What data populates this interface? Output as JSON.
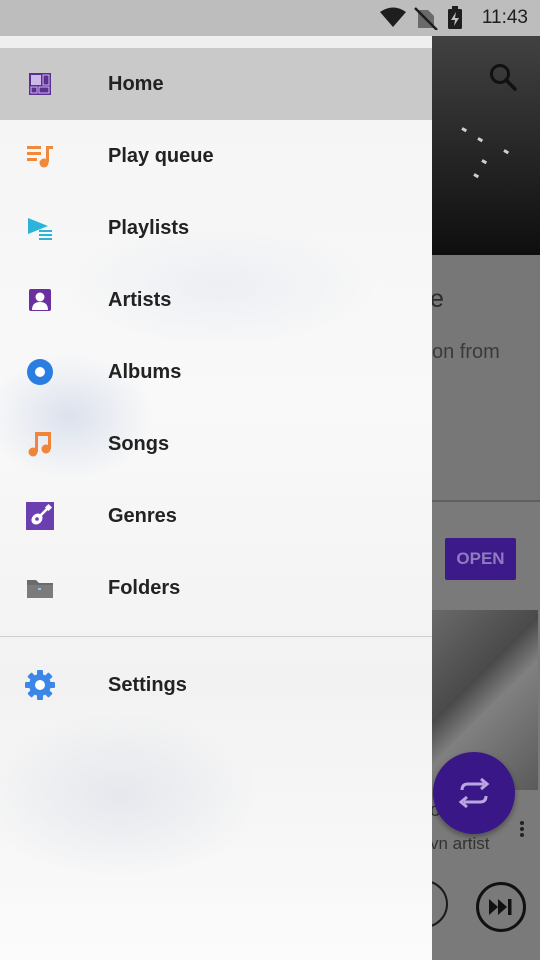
{
  "status_bar": {
    "time": "11:43",
    "icons": [
      "wifi-icon",
      "no-sim-icon",
      "battery-charging-icon"
    ]
  },
  "background": {
    "card_title_fragment": "e",
    "card_sub_fragment": "on from",
    "open_button": "OPEN",
    "album_title_fragment": "o",
    "album_artist_fragment": "vn artist"
  },
  "drawer": {
    "items": [
      {
        "label": "Home",
        "icon": "home-icon",
        "color": "#5b2e91",
        "active": true
      },
      {
        "label": "Play queue",
        "icon": "play-queue-icon",
        "color": "#f08a3a"
      },
      {
        "label": "Playlists",
        "icon": "playlists-icon",
        "color": "#2bb3d9"
      },
      {
        "label": "Artists",
        "icon": "artists-icon",
        "color": "#6a2fa0"
      },
      {
        "label": "Albums",
        "icon": "albums-icon",
        "color": "#2a7de1"
      },
      {
        "label": "Songs",
        "icon": "songs-icon",
        "color": "#f0843a"
      },
      {
        "label": "Genres",
        "icon": "genres-icon",
        "color": "#6a3fb0"
      },
      {
        "label": "Folders",
        "icon": "folders-icon",
        "color": "#6b6b6b"
      }
    ],
    "settings": {
      "label": "Settings",
      "icon": "settings-icon",
      "color": "#3b86e6"
    }
  }
}
